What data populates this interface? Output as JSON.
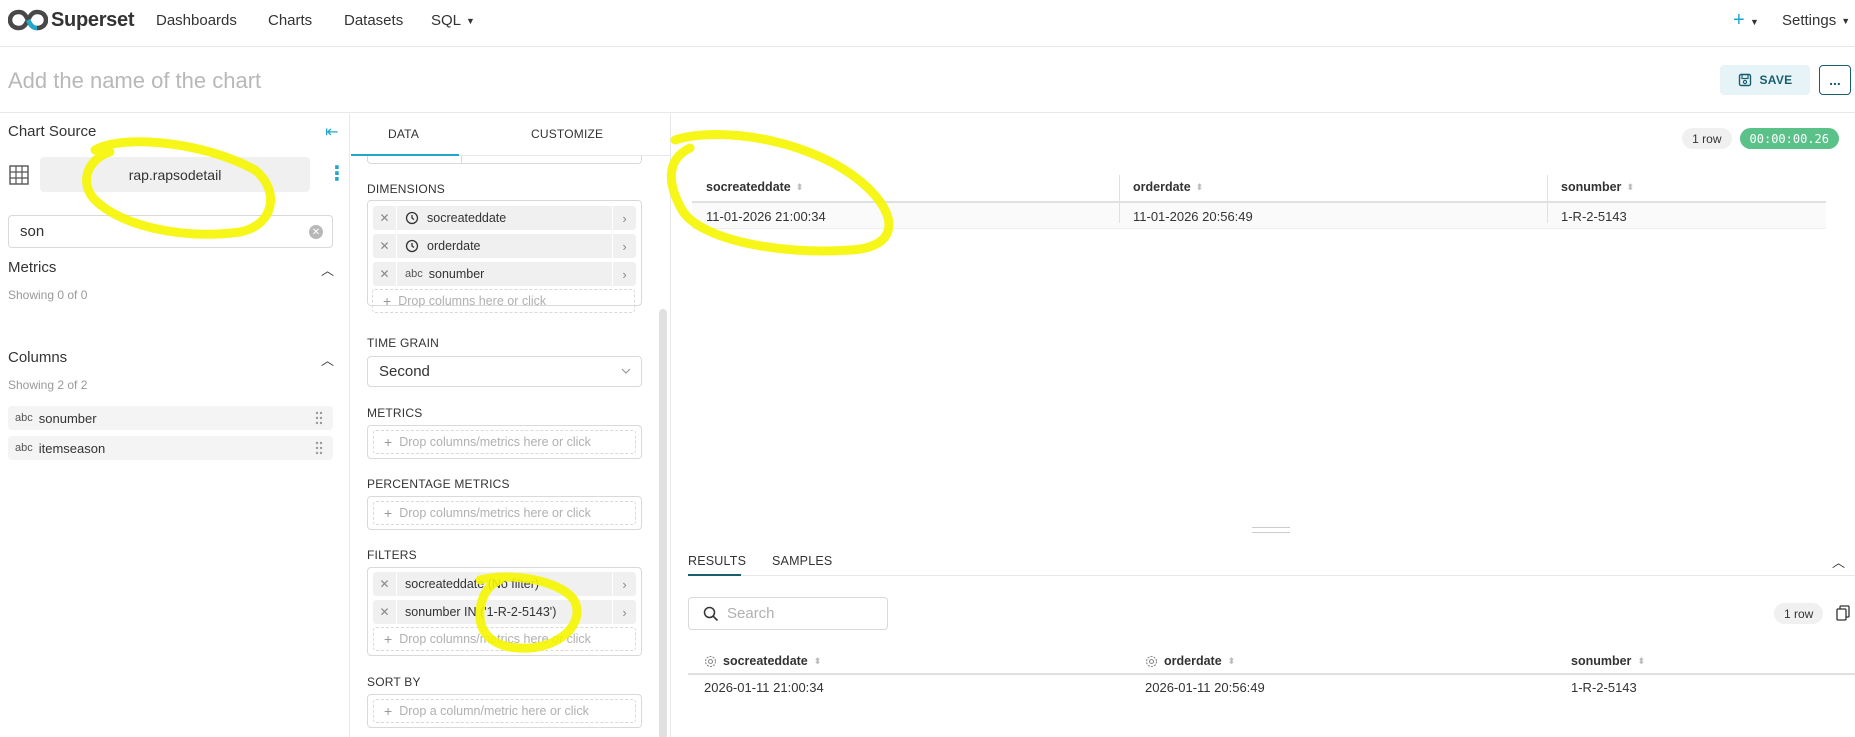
{
  "navbar": {
    "brand": "Superset",
    "items": [
      "Dashboards",
      "Charts",
      "Datasets",
      "SQL"
    ],
    "settings": "Settings"
  },
  "header": {
    "chart_name_placeholder": "Add the name of the chart",
    "save_label": "SAVE",
    "more_label": "..."
  },
  "datasource": {
    "title": "Chart Source",
    "name": "rap.rapsodetail",
    "search_value": "son",
    "metrics_title": "Metrics",
    "metrics_count": "Showing 0 of 0",
    "columns_title": "Columns",
    "columns_count": "Showing 2 of 2",
    "columns": [
      {
        "type": "abc",
        "name": "sonumber"
      },
      {
        "type": "abc",
        "name": "itemseason"
      }
    ]
  },
  "controls": {
    "tabs": [
      "DATA",
      "CUSTOMIZE"
    ],
    "dimensions_label": "DIMENSIONS",
    "dimensions": [
      {
        "type": "time",
        "name": "socreateddate"
      },
      {
        "type": "time",
        "name": "orderdate"
      },
      {
        "type": "abc",
        "name": "sonumber"
      }
    ],
    "dimensions_hint": "Drop columns here or click",
    "time_grain_label": "TIME GRAIN",
    "time_grain_value": "Second",
    "metrics_label": "METRICS",
    "metrics_hint": "Drop columns/metrics here or click",
    "pct_metrics_label": "PERCENTAGE METRICS",
    "pct_metrics_hint": "Drop columns/metrics here or click",
    "filters_label": "FILTERS",
    "filters": [
      "socreateddate (No filter)",
      "sonumber IN ('1-R-2-5143')"
    ],
    "filters_hint": "Drop columns/metrics here or click",
    "sort_by_label": "SORT BY",
    "sort_by_hint": "Drop a column/metric here or click"
  },
  "chart": {
    "row_badge": "1 row",
    "time_badge": "00:00:00.26",
    "columns": [
      "socreateddate",
      "orderdate",
      "sonumber"
    ],
    "rows": [
      [
        "11-01-2026 21:00:34",
        "11-01-2026 20:56:49",
        "1-R-2-5143"
      ]
    ]
  },
  "results": {
    "tabs": [
      "RESULTS",
      "SAMPLES"
    ],
    "search_placeholder": "Search",
    "row_badge": "1 row",
    "columns": [
      "socreateddate",
      "orderdate",
      "sonumber"
    ],
    "rows": [
      [
        "2026-01-11 21:00:34",
        "2026-01-11 20:56:49",
        "1-R-2-5143"
      ]
    ]
  },
  "colors": {
    "accent": "#20a7c9",
    "primary_dark": "#1a5e6e",
    "success": "#5ac189",
    "highlight": "#f5f500"
  }
}
